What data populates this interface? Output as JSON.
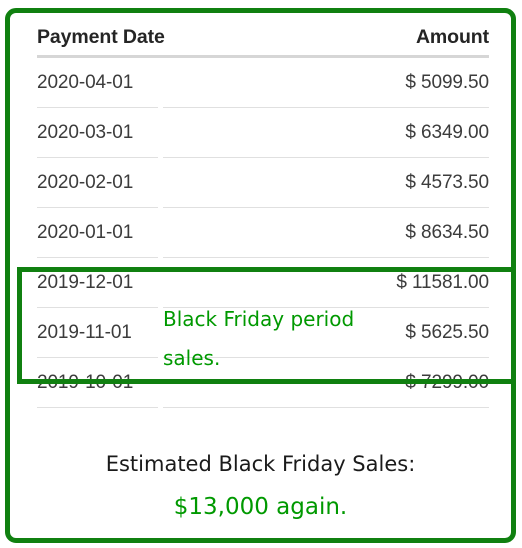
{
  "card": {
    "border_color": "#108010",
    "background": "#ffffff"
  },
  "table": {
    "columns": [
      {
        "key": "payment_date",
        "label": "Payment Date",
        "align": "left"
      },
      {
        "key": "amount",
        "label": "Amount",
        "align": "right"
      }
    ],
    "rows": [
      {
        "payment_date": "2020-04-01",
        "amount": "$ 5099.50",
        "highlighted": false
      },
      {
        "payment_date": "2020-03-01",
        "amount": "$ 6349.00",
        "highlighted": false
      },
      {
        "payment_date": "2020-02-01",
        "amount": "$ 4573.50",
        "highlighted": false
      },
      {
        "payment_date": "2020-01-01",
        "amount": "$ 8634.50",
        "highlighted": false
      },
      {
        "payment_date": "2019-12-01",
        "amount": "$ 11581.00",
        "highlighted": true
      },
      {
        "payment_date": "2019-11-01",
        "amount": "$ 5625.50",
        "highlighted": true
      },
      {
        "payment_date": "2019-10-01",
        "amount": "$ 7299.00",
        "highlighted": false
      }
    ]
  },
  "annotation": {
    "text": "Black Friday period sales.",
    "color": "#009900"
  },
  "footer": {
    "line1": "Estimated Black Friday Sales:",
    "line1_color": "#1a1a1a",
    "line2": "$13,000 again.",
    "line2_color": "#009900"
  }
}
